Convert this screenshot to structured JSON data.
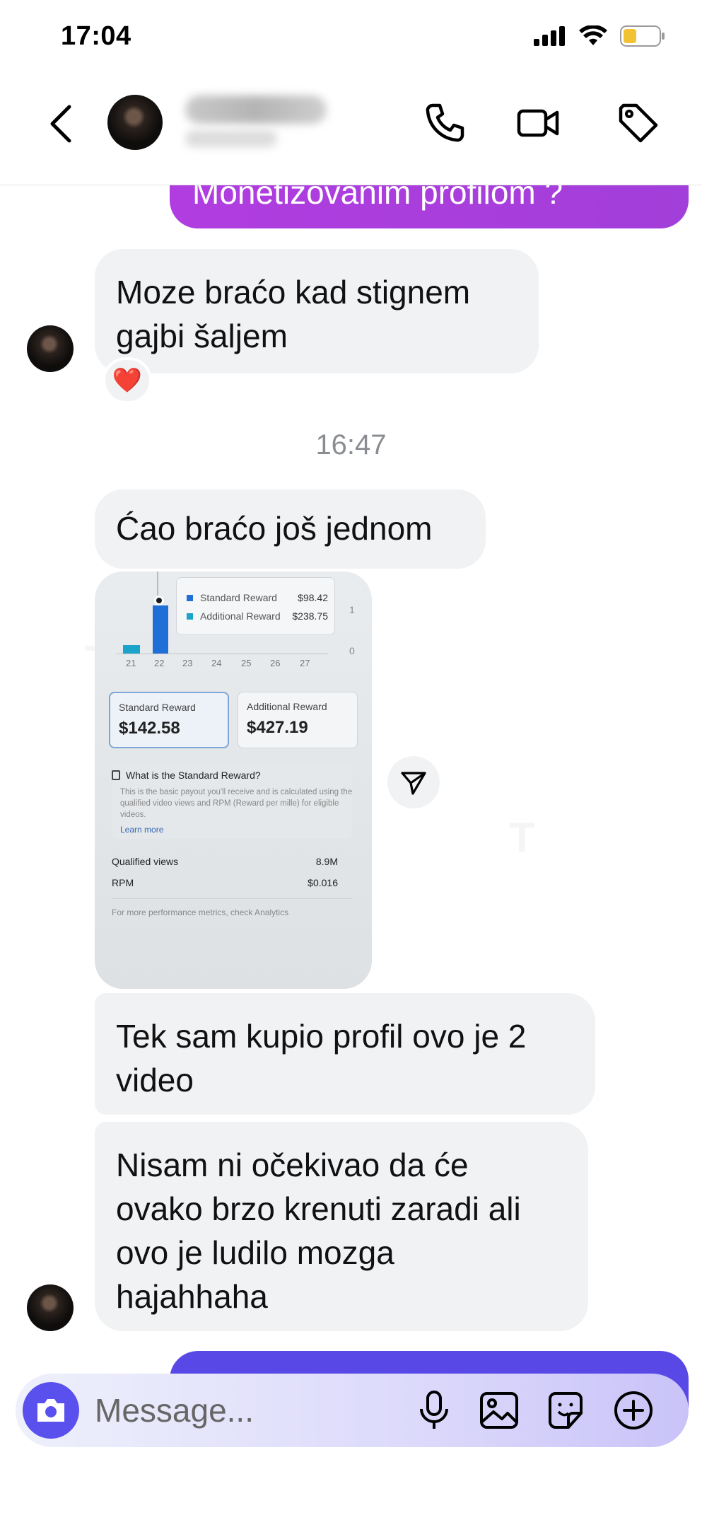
{
  "status_bar": {
    "time": "17:04"
  },
  "header": {
    "back_icon": "chevron-left-icon",
    "actions": [
      {
        "name": "audio-call-button",
        "icon": "phone-icon"
      },
      {
        "name": "video-call-button",
        "icon": "video-camera-icon"
      },
      {
        "name": "label-button",
        "icon": "tag-icon"
      }
    ]
  },
  "messages": {
    "outgoing_top": "Monetizovanim profilom ?",
    "incoming_1": [
      "Moze braćo kad stignem",
      "gajbi šaljem"
    ],
    "reaction": "❤️",
    "timestamp": "16:47",
    "incoming_2": "Ćao braćo još jednom",
    "incoming_3": [
      "Tek sam kupio profil ovo je 2",
      "video"
    ],
    "incoming_4": [
      "Nisam ni očekivao da će",
      "ovako brzo krenuti zaradi ali",
      "ovo je ludilo mozga",
      "hajahhaha"
    ]
  },
  "screenshot": {
    "legend": [
      {
        "label": "Standard Reward",
        "value": "$98.42",
        "color": "#1f6fd6"
      },
      {
        "label": "Additional Reward",
        "value": "$238.75",
        "color": "#1ba3c9"
      }
    ],
    "axis_right_top": "1",
    "axis_right_bottom": "0",
    "x_ticks": [
      "21",
      "22",
      "23",
      "24",
      "25",
      "26",
      "27"
    ],
    "standard_card": {
      "label": "Standard Reward",
      "amount": "$142.58"
    },
    "additional_card": {
      "label": "Additional Reward",
      "amount": "$427.19"
    },
    "question": "What is the Standard Reward?",
    "description": "This is the basic payout you'll receive and is calculated using the qualified video views and RPM (Reward per mille) for eligible videos.",
    "learn_more": "Learn more",
    "qualified_views_label": "Qualified views",
    "qualified_views_value": "8.9M",
    "rpm_label": "RPM",
    "rpm_value": "$0.016",
    "footer": "For more performance metrics, check Analytics"
  },
  "composer": {
    "placeholder": "Message..."
  },
  "colors": {
    "outgoing_purple": "#a23ed9",
    "composer_accent": "#5a50ee",
    "incoming_bubble": "#f1f2f4"
  }
}
